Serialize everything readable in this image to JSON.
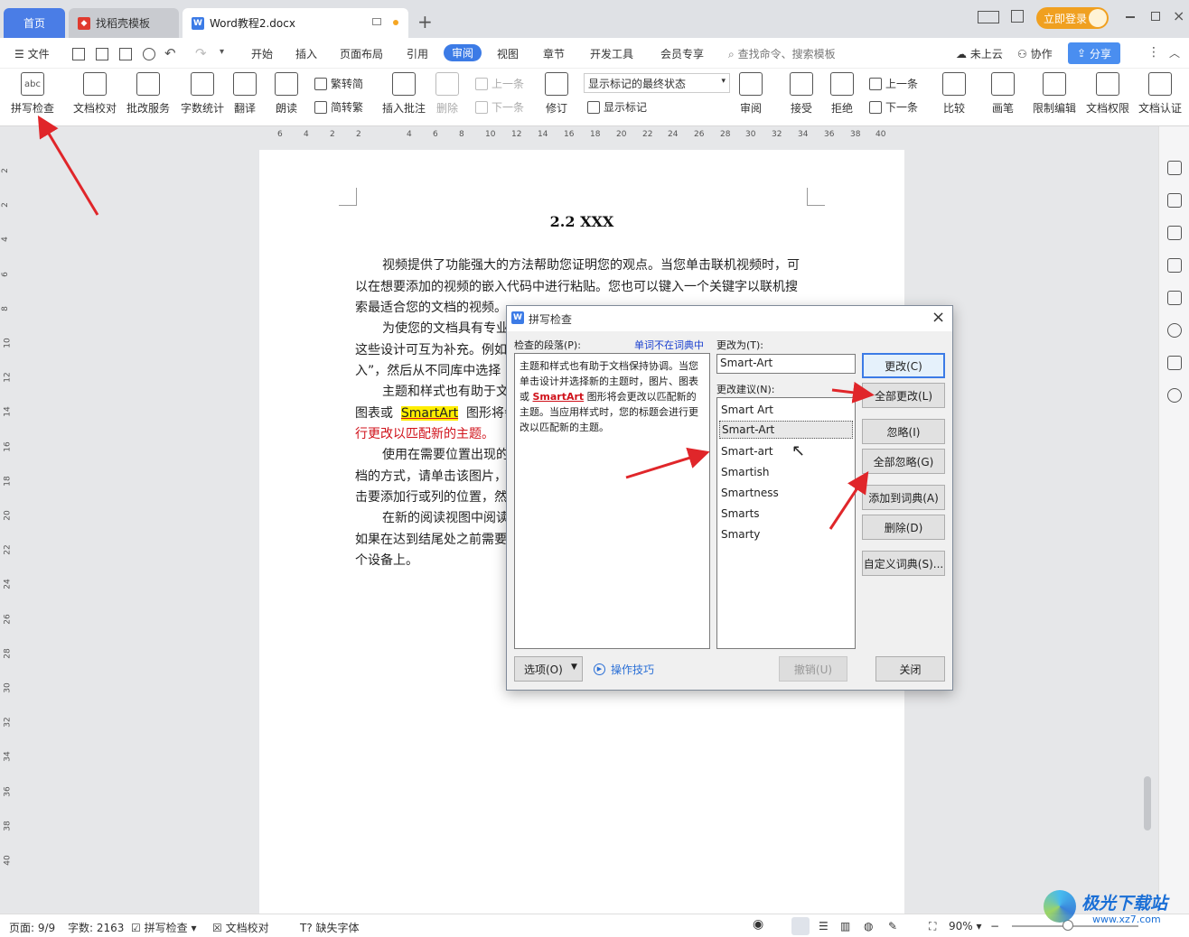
{
  "tabs": {
    "home": "首页",
    "template": "找稻壳模板",
    "doc": "Word教程2.docx",
    "add": "+"
  },
  "top_right": {
    "login": "立即登录"
  },
  "menu": {
    "file": "文件",
    "items": [
      "开始",
      "插入",
      "页面布局",
      "引用",
      "审阅",
      "视图",
      "章节",
      "开发工具",
      "会员专享"
    ],
    "active": "审阅",
    "search": "查找命令、搜索模板",
    "cloud": "未上云",
    "collab": "协作",
    "share": "分享"
  },
  "ribbon": {
    "spell": "拼写检查",
    "proof": "文档校对",
    "review_service": "批改服务",
    "word_count": "字数统计",
    "translate": "翻译",
    "read": "朗读",
    "trad": "繁转简",
    "simp": "简转繁",
    "insert_comment": "插入批注",
    "delete": "删除",
    "prev": "上一条",
    "next": "下一条",
    "revise": "修订",
    "markup_state": "显示标记的最终状态",
    "show_markup": "显示标记",
    "review": "审阅",
    "accept": "接受",
    "reject": "拒绝",
    "prev2": "上一条",
    "next2": "下一条",
    "compare": "比较",
    "pen": "画笔",
    "restrict": "限制编辑",
    "permission": "文档权限",
    "cert": "文档认证"
  },
  "ruler_h": [
    "6",
    "4",
    "2",
    "2",
    "4",
    "6",
    "8",
    "10",
    "12",
    "14",
    "16",
    "18",
    "20",
    "22",
    "24",
    "26",
    "28",
    "30",
    "32",
    "34",
    "36",
    "38",
    "40"
  ],
  "ruler_v": [
    "2",
    "2",
    "4",
    "6",
    "8",
    "10",
    "12",
    "14",
    "16",
    "18",
    "20",
    "22",
    "24",
    "26",
    "28",
    "30",
    "32",
    "34",
    "36",
    "38",
    "40"
  ],
  "document": {
    "title": "2.2 XXX",
    "lines": [
      "视频提供了功能强大的方法帮助您证明您的观点。当您单击联机视频时，可",
      "以在想要添加的视频的嵌入代码中进行粘贴。您也可以键入一个关键字以联机搜",
      "索最适合您的文档的视频。",
      "为使您的文档具有专业",
      "这些设计可互为补充。例如",
      "入”，然后从不同库中选择",
      "主题和样式也有助于文",
      "图表或",
      "SmartArt",
      "图形将会",
      "行更改以匹配新的主题。",
      "使用在需要位置出现的",
      "档的方式，请单击该图片，",
      "击要添加行或列的位置，然",
      "在新的阅读视图中阅读",
      "如果在达到结尾处之前需要",
      "个设备上。"
    ]
  },
  "dialog": {
    "title": "拼写检查",
    "para_label": "检查的段落(P):",
    "not_in_dict": "单词不在词典中",
    "change_to_label": "更改为(T):",
    "change_to_value": "Smart-Art",
    "suggest_label": "更改建议(N):",
    "para_before": "主题和样式也有助于文档保持协调。当您单击设计并选择新的主题时，图片、图表或 ",
    "para_word": "SmartArt",
    "para_after": " 图形将会更改以匹配新的主题。当应用样式时，您的标题会进行更改以匹配新的主题。",
    "suggestions": [
      "Smart Art",
      "Smart-Art",
      "Smart-art",
      "Smartish",
      "Smartness",
      "Smarts",
      "Smarty"
    ],
    "selected_suggestion": "Smart-Art",
    "buttons": {
      "change": "更改(C)",
      "change_all": "全部更改(L)",
      "ignore": "忽略(I)",
      "ignore_all": "全部忽略(G)",
      "add_dict": "添加到词典(A)",
      "delete": "删除(D)",
      "custom_dict": "自定义词典(S)...",
      "options": "选项(O)",
      "tips": "操作技巧",
      "undo": "撤销(U)",
      "close": "关闭"
    }
  },
  "status": {
    "page": "页面: 9/9",
    "words": "字数: 2163",
    "spell": "拼写检查",
    "proof": "文档校对",
    "missing_font": "缺失字体",
    "zoom": "90%"
  },
  "watermark": {
    "brand": "极光下载站",
    "url": "www.xz7.com"
  },
  "colors": {
    "accent": "#3c7be6",
    "arrow": "#e0262a",
    "highlight": "#ffee00"
  }
}
